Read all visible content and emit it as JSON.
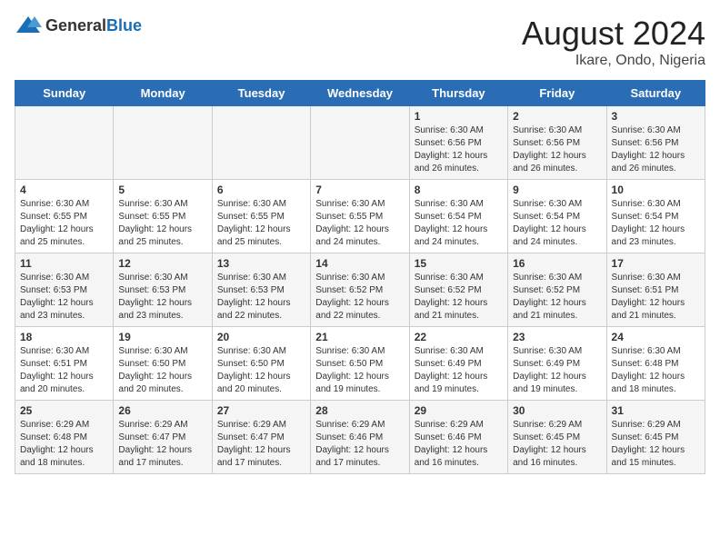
{
  "header": {
    "logo_general": "General",
    "logo_blue": "Blue",
    "title": "August 2024",
    "subtitle": "Ikare, Ondo, Nigeria"
  },
  "days_of_week": [
    "Sunday",
    "Monday",
    "Tuesday",
    "Wednesday",
    "Thursday",
    "Friday",
    "Saturday"
  ],
  "weeks": [
    [
      {
        "day": "",
        "content": ""
      },
      {
        "day": "",
        "content": ""
      },
      {
        "day": "",
        "content": ""
      },
      {
        "day": "",
        "content": ""
      },
      {
        "day": "1",
        "content": "Sunrise: 6:30 AM\nSunset: 6:56 PM\nDaylight: 12 hours\nand 26 minutes."
      },
      {
        "day": "2",
        "content": "Sunrise: 6:30 AM\nSunset: 6:56 PM\nDaylight: 12 hours\nand 26 minutes."
      },
      {
        "day": "3",
        "content": "Sunrise: 6:30 AM\nSunset: 6:56 PM\nDaylight: 12 hours\nand 26 minutes."
      }
    ],
    [
      {
        "day": "4",
        "content": "Sunrise: 6:30 AM\nSunset: 6:55 PM\nDaylight: 12 hours\nand 25 minutes."
      },
      {
        "day": "5",
        "content": "Sunrise: 6:30 AM\nSunset: 6:55 PM\nDaylight: 12 hours\nand 25 minutes."
      },
      {
        "day": "6",
        "content": "Sunrise: 6:30 AM\nSunset: 6:55 PM\nDaylight: 12 hours\nand 25 minutes."
      },
      {
        "day": "7",
        "content": "Sunrise: 6:30 AM\nSunset: 6:55 PM\nDaylight: 12 hours\nand 24 minutes."
      },
      {
        "day": "8",
        "content": "Sunrise: 6:30 AM\nSunset: 6:54 PM\nDaylight: 12 hours\nand 24 minutes."
      },
      {
        "day": "9",
        "content": "Sunrise: 6:30 AM\nSunset: 6:54 PM\nDaylight: 12 hours\nand 24 minutes."
      },
      {
        "day": "10",
        "content": "Sunrise: 6:30 AM\nSunset: 6:54 PM\nDaylight: 12 hours\nand 23 minutes."
      }
    ],
    [
      {
        "day": "11",
        "content": "Sunrise: 6:30 AM\nSunset: 6:53 PM\nDaylight: 12 hours\nand 23 minutes."
      },
      {
        "day": "12",
        "content": "Sunrise: 6:30 AM\nSunset: 6:53 PM\nDaylight: 12 hours\nand 23 minutes."
      },
      {
        "day": "13",
        "content": "Sunrise: 6:30 AM\nSunset: 6:53 PM\nDaylight: 12 hours\nand 22 minutes."
      },
      {
        "day": "14",
        "content": "Sunrise: 6:30 AM\nSunset: 6:52 PM\nDaylight: 12 hours\nand 22 minutes."
      },
      {
        "day": "15",
        "content": "Sunrise: 6:30 AM\nSunset: 6:52 PM\nDaylight: 12 hours\nand 21 minutes."
      },
      {
        "day": "16",
        "content": "Sunrise: 6:30 AM\nSunset: 6:52 PM\nDaylight: 12 hours\nand 21 minutes."
      },
      {
        "day": "17",
        "content": "Sunrise: 6:30 AM\nSunset: 6:51 PM\nDaylight: 12 hours\nand 21 minutes."
      }
    ],
    [
      {
        "day": "18",
        "content": "Sunrise: 6:30 AM\nSunset: 6:51 PM\nDaylight: 12 hours\nand 20 minutes."
      },
      {
        "day": "19",
        "content": "Sunrise: 6:30 AM\nSunset: 6:50 PM\nDaylight: 12 hours\nand 20 minutes."
      },
      {
        "day": "20",
        "content": "Sunrise: 6:30 AM\nSunset: 6:50 PM\nDaylight: 12 hours\nand 20 minutes."
      },
      {
        "day": "21",
        "content": "Sunrise: 6:30 AM\nSunset: 6:50 PM\nDaylight: 12 hours\nand 19 minutes."
      },
      {
        "day": "22",
        "content": "Sunrise: 6:30 AM\nSunset: 6:49 PM\nDaylight: 12 hours\nand 19 minutes."
      },
      {
        "day": "23",
        "content": "Sunrise: 6:30 AM\nSunset: 6:49 PM\nDaylight: 12 hours\nand 19 minutes."
      },
      {
        "day": "24",
        "content": "Sunrise: 6:30 AM\nSunset: 6:48 PM\nDaylight: 12 hours\nand 18 minutes."
      }
    ],
    [
      {
        "day": "25",
        "content": "Sunrise: 6:29 AM\nSunset: 6:48 PM\nDaylight: 12 hours\nand 18 minutes."
      },
      {
        "day": "26",
        "content": "Sunrise: 6:29 AM\nSunset: 6:47 PM\nDaylight: 12 hours\nand 17 minutes."
      },
      {
        "day": "27",
        "content": "Sunrise: 6:29 AM\nSunset: 6:47 PM\nDaylight: 12 hours\nand 17 minutes."
      },
      {
        "day": "28",
        "content": "Sunrise: 6:29 AM\nSunset: 6:46 PM\nDaylight: 12 hours\nand 17 minutes."
      },
      {
        "day": "29",
        "content": "Sunrise: 6:29 AM\nSunset: 6:46 PM\nDaylight: 12 hours\nand 16 minutes."
      },
      {
        "day": "30",
        "content": "Sunrise: 6:29 AM\nSunset: 6:45 PM\nDaylight: 12 hours\nand 16 minutes."
      },
      {
        "day": "31",
        "content": "Sunrise: 6:29 AM\nSunset: 6:45 PM\nDaylight: 12 hours\nand 15 minutes."
      }
    ]
  ]
}
